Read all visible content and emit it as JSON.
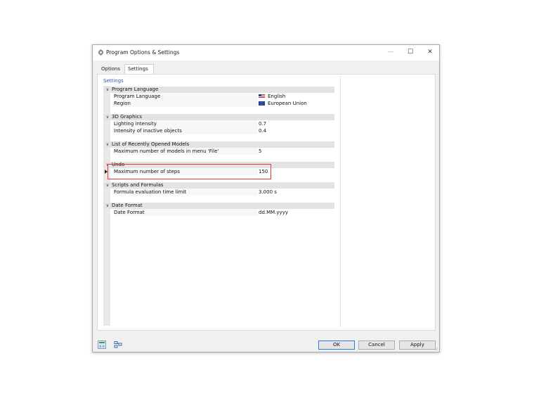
{
  "window": {
    "title": "Program Options & Settings",
    "minimize": "—",
    "maximize": "☐",
    "close": "✕"
  },
  "tabs": [
    {
      "label": "Options"
    },
    {
      "label": "Settings"
    }
  ],
  "panel": {
    "header": "Settings"
  },
  "groups": [
    {
      "label": "Program Language",
      "rows": [
        {
          "name": "Program Language",
          "value": "English",
          "flag": "us"
        },
        {
          "name": "Region",
          "value": "European Union",
          "flag": "eu"
        }
      ]
    },
    {
      "label": "3D Graphics",
      "rows": [
        {
          "name": "Lighting intensity",
          "value": "0.7"
        },
        {
          "name": "Intensity of inactive objects",
          "value": "0.4"
        }
      ]
    },
    {
      "label": "List of Recently Opened Models",
      "rows": [
        {
          "name": "Maximum number of models in menu 'File'",
          "value": "5"
        }
      ]
    },
    {
      "label": "Undo",
      "rows": [
        {
          "name": "Maximum number of steps",
          "value": "150"
        }
      ]
    },
    {
      "label": "Scripts and Formulas",
      "rows": [
        {
          "name": "Formula evaluation time limit",
          "value": "3.000 s"
        }
      ]
    },
    {
      "label": "Date Format",
      "rows": [
        {
          "name": "Date Format",
          "value": "dd.MM.yyyy"
        }
      ]
    }
  ],
  "footer": {
    "ok": "OK",
    "cancel": "Cancel",
    "apply": "Apply"
  },
  "colors": {
    "highlight": "#e23a3a",
    "accent": "#2f7bd6",
    "section_bg": "#e3e3e3"
  },
  "icons": {
    "app": "program-gear-icon",
    "footer_left": [
      "units-icon",
      "table-icon"
    ]
  }
}
